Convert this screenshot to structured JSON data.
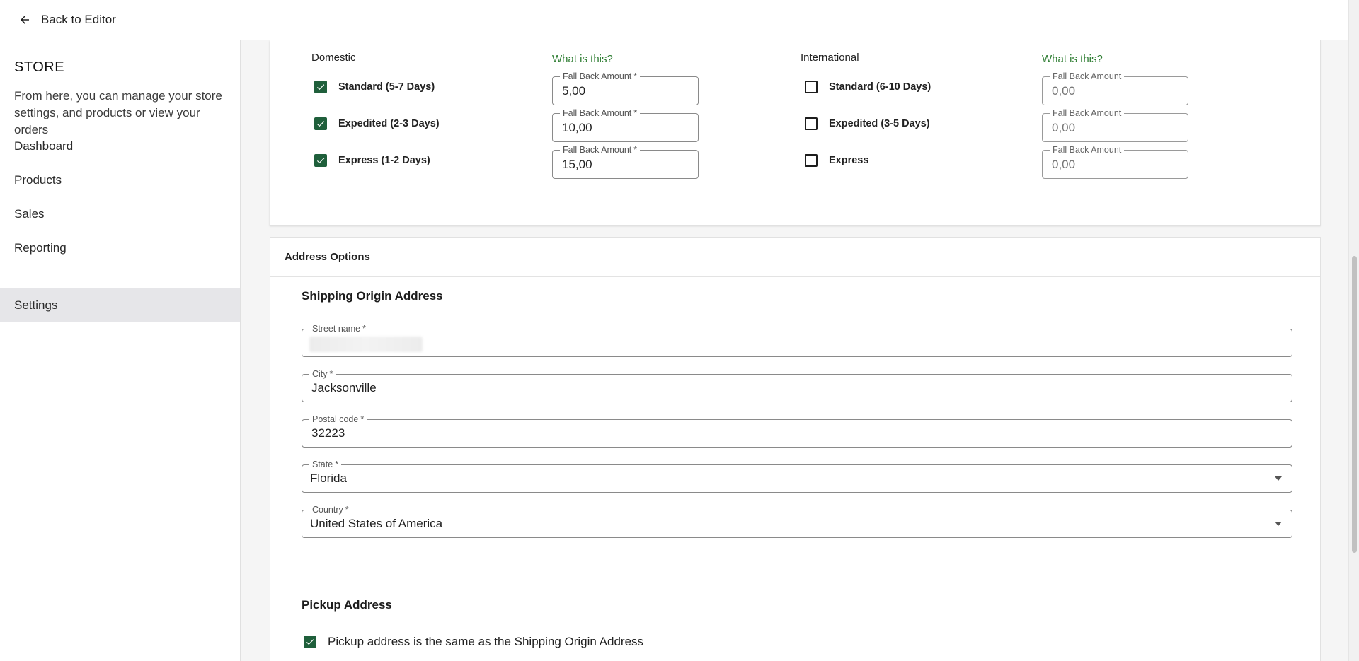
{
  "topbar": {
    "back_label": "Back to Editor"
  },
  "sidebar": {
    "title": "STORE",
    "description": "From here, you can manage your store settings, and products or view your orders",
    "items": [
      {
        "label": "Dashboard",
        "active": false
      },
      {
        "label": "Products",
        "active": false
      },
      {
        "label": "Sales",
        "active": false
      },
      {
        "label": "Reporting",
        "active": false
      },
      {
        "label": "Settings",
        "active": true
      }
    ]
  },
  "shipping": {
    "domestic": {
      "heading": "Domestic",
      "help_link": "What is this?",
      "options": [
        {
          "label": "Standard (5-7 Days)",
          "checked": true,
          "field_label": "Fall Back Amount",
          "required": "*",
          "value": "5,00"
        },
        {
          "label": "Expedited (2-3 Days)",
          "checked": true,
          "field_label": "Fall Back Amount",
          "required": "*",
          "value": "10,00"
        },
        {
          "label": "Express (1-2 Days)",
          "checked": true,
          "field_label": "Fall Back Amount",
          "required": "*",
          "value": "15,00"
        }
      ]
    },
    "international": {
      "heading": "International",
      "help_link": "What is this?",
      "options": [
        {
          "label": "Standard (6-10 Days)",
          "checked": false,
          "field_label": "Fall Back Amount",
          "placeholder": "0,00"
        },
        {
          "label": "Expedited (3-5 Days)",
          "checked": false,
          "field_label": "Fall Back Amount",
          "placeholder": "0,00"
        },
        {
          "label": "Express",
          "checked": false,
          "field_label": "Fall Back Amount",
          "placeholder": "0,00"
        }
      ]
    }
  },
  "address_options": {
    "header": "Address Options",
    "origin": {
      "title": "Shipping Origin Address",
      "street": {
        "label": "Street name",
        "required": "*",
        "value": ""
      },
      "city": {
        "label": "City",
        "required": "*",
        "value": "Jacksonville"
      },
      "postal": {
        "label": "Postal code",
        "required": "*",
        "value": "32223"
      },
      "state": {
        "label": "State",
        "required": "*",
        "value": "Florida"
      },
      "country": {
        "label": "Country",
        "required": "*",
        "value": "United States of America"
      }
    },
    "pickup": {
      "title": "Pickup Address",
      "same_label": "Pickup address is the same as the Shipping Origin Address",
      "same_checked": true
    }
  },
  "colors": {
    "accent": "#1f5f3b",
    "link": "#2e7d32",
    "nav_active_bg": "#e6e6e9"
  }
}
